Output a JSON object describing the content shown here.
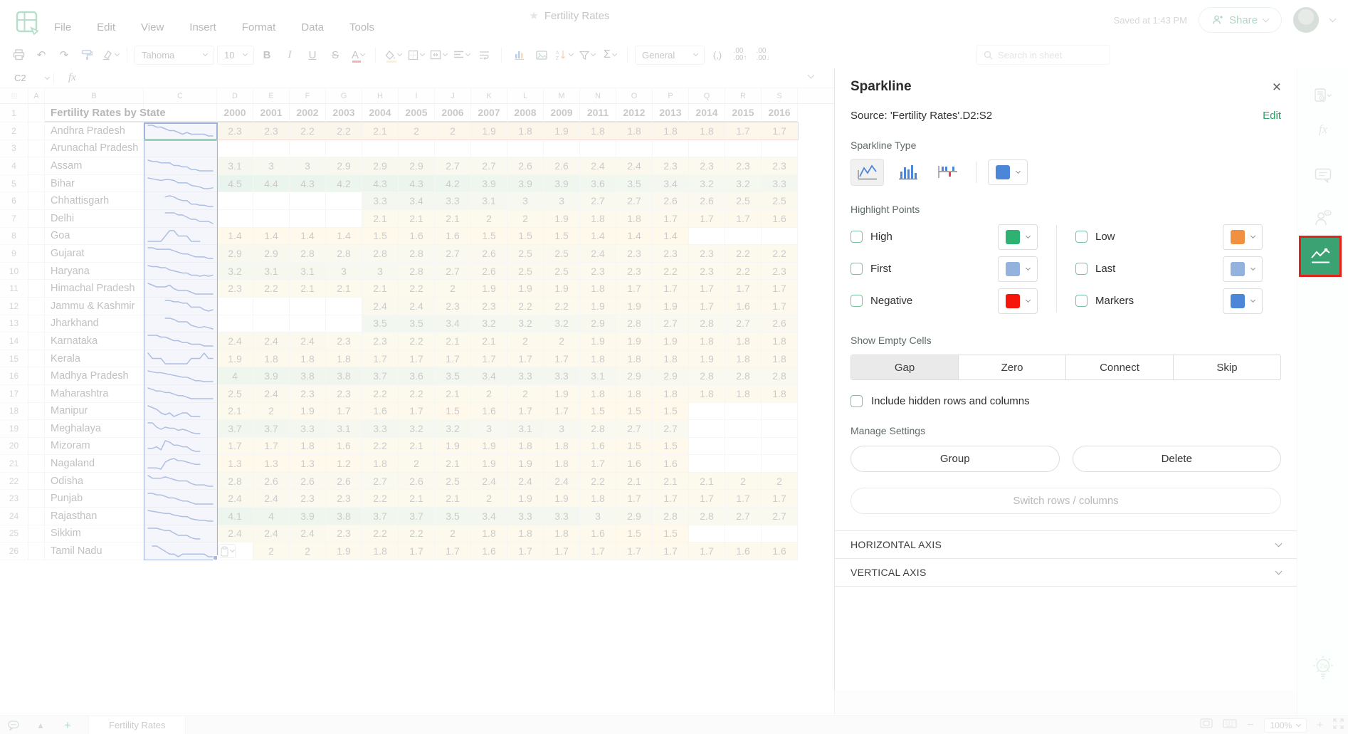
{
  "header": {
    "menus": [
      "File",
      "Edit",
      "View",
      "Insert",
      "Format",
      "Data",
      "Tools"
    ],
    "title": "Fertility Rates",
    "saved": "Saved at 1:43 PM",
    "share": "Share"
  },
  "toolbar": {
    "font_name": "Tahoma",
    "font_size": "10",
    "bold": "B",
    "italic": "I",
    "underline": "U",
    "strike": "S",
    "font_color": "A",
    "sigma": "Σ",
    "comma": "(,)",
    "decimal": ".00",
    "number_format": "General",
    "search_placeholder": "Search in sheet"
  },
  "formula_bar": {
    "cell_ref": "C2",
    "fx": "fx"
  },
  "sheet": {
    "column_letters": [
      "A",
      "B",
      "C",
      "D",
      "E",
      "F",
      "G",
      "H",
      "I",
      "J",
      "K",
      "L",
      "M",
      "N",
      "O",
      "P",
      "Q",
      "R",
      "S"
    ],
    "title_cell": "Fertility Rates by State",
    "years": [
      2000,
      2001,
      2002,
      2003,
      2004,
      2005,
      2006,
      2007,
      2008,
      2009,
      2011,
      2012,
      2013,
      2014,
      2015,
      2016
    ],
    "rows": [
      {
        "row": 2,
        "state": "Andhra Pradesh",
        "values": [
          2.3,
          2.3,
          2.2,
          2.2,
          2.1,
          2,
          2,
          1.9,
          1.8,
          1.9,
          1.8,
          1.8,
          1.8,
          1.8,
          1.7,
          1.7
        ]
      },
      {
        "row": 3,
        "state": "Arunachal Pradesh",
        "values": [
          null,
          null,
          null,
          null,
          null,
          null,
          null,
          null,
          null,
          null,
          null,
          null,
          null,
          null,
          null,
          null
        ]
      },
      {
        "row": 4,
        "state": "Assam",
        "values": [
          3.1,
          3,
          3,
          2.9,
          2.9,
          2.9,
          2.7,
          2.7,
          2.6,
          2.6,
          2.4,
          2.4,
          2.3,
          2.3,
          2.3,
          2.3
        ]
      },
      {
        "row": 5,
        "state": "Bihar",
        "values": [
          4.5,
          4.4,
          4.3,
          4.2,
          4.3,
          4.3,
          4.2,
          3.9,
          3.9,
          3.9,
          3.6,
          3.5,
          3.4,
          3.2,
          3.2,
          3.3
        ]
      },
      {
        "row": 6,
        "state": "Chhattisgarh",
        "values": [
          null,
          null,
          null,
          null,
          3.3,
          3.4,
          3.3,
          3.1,
          3,
          3,
          2.7,
          2.7,
          2.6,
          2.6,
          2.5,
          2.5
        ]
      },
      {
        "row": 7,
        "state": "Delhi",
        "values": [
          null,
          null,
          null,
          null,
          2.1,
          2.1,
          2.1,
          2,
          2,
          1.9,
          1.8,
          1.8,
          1.7,
          1.7,
          1.7,
          1.6
        ]
      },
      {
        "row": 8,
        "state": "Goa",
        "values": [
          1.4,
          1.4,
          1.4,
          1.4,
          1.5,
          1.6,
          1.6,
          1.5,
          1.5,
          1.5,
          1.4,
          1.4,
          1.4,
          null,
          null,
          null
        ]
      },
      {
        "row": 9,
        "state": "Gujarat",
        "values": [
          2.9,
          2.9,
          2.8,
          2.8,
          2.8,
          2.8,
          2.7,
          2.6,
          2.5,
          2.5,
          2.4,
          2.3,
          2.3,
          2.3,
          2.2,
          2.2
        ]
      },
      {
        "row": 10,
        "state": "Haryana",
        "values": [
          3.2,
          3.1,
          3.1,
          3,
          3,
          2.8,
          2.7,
          2.6,
          2.5,
          2.5,
          2.3,
          2.3,
          2.2,
          2.3,
          2.2,
          2.3
        ]
      },
      {
        "row": 11,
        "state": "Himachal Pradesh",
        "values": [
          2.3,
          2.2,
          2.1,
          2.1,
          2.1,
          2.2,
          2,
          1.9,
          1.9,
          1.9,
          1.8,
          1.7,
          1.7,
          1.7,
          1.7,
          1.7
        ]
      },
      {
        "row": 12,
        "state": "Jammu & Kashmir",
        "values": [
          null,
          null,
          null,
          null,
          2.4,
          2.4,
          2.3,
          2.3,
          2.2,
          2.2,
          1.9,
          1.9,
          1.9,
          1.7,
          1.6,
          1.7
        ]
      },
      {
        "row": 13,
        "state": "Jharkhand",
        "values": [
          null,
          null,
          null,
          null,
          3.5,
          3.5,
          3.4,
          3.2,
          3.2,
          3.2,
          2.9,
          2.8,
          2.7,
          2.8,
          2.7,
          2.6
        ]
      },
      {
        "row": 14,
        "state": "Karnataka",
        "values": [
          2.4,
          2.4,
          2.4,
          2.3,
          2.3,
          2.2,
          2.1,
          2.1,
          2,
          2,
          1.9,
          1.9,
          1.9,
          1.8,
          1.8,
          1.8
        ]
      },
      {
        "row": 15,
        "state": "Kerala",
        "values": [
          1.9,
          1.8,
          1.8,
          1.8,
          1.7,
          1.7,
          1.7,
          1.7,
          1.7,
          1.7,
          1.8,
          1.8,
          1.8,
          1.9,
          1.8,
          1.8
        ]
      },
      {
        "row": 16,
        "state": "Madhya Pradesh",
        "values": [
          4,
          3.9,
          3.8,
          3.8,
          3.7,
          3.6,
          3.5,
          3.4,
          3.3,
          3.3,
          3.1,
          2.9,
          2.9,
          2.8,
          2.8,
          2.8
        ]
      },
      {
        "row": 17,
        "state": "Maharashtra",
        "values": [
          2.5,
          2.4,
          2.3,
          2.3,
          2.2,
          2.2,
          2.1,
          2,
          2,
          1.9,
          1.8,
          1.8,
          1.8,
          1.8,
          1.8,
          1.8
        ]
      },
      {
        "row": 18,
        "state": "Manipur",
        "values": [
          2.1,
          2,
          1.9,
          1.7,
          1.6,
          1.7,
          1.5,
          1.6,
          1.7,
          1.7,
          1.5,
          1.5,
          1.5,
          null,
          null,
          null
        ]
      },
      {
        "row": 19,
        "state": "Meghalaya",
        "values": [
          3.7,
          3.7,
          3.3,
          3.1,
          3.3,
          3.2,
          3.2,
          3,
          3.1,
          3,
          2.8,
          2.7,
          2.7,
          null,
          null,
          null
        ]
      },
      {
        "row": 20,
        "state": "Mizoram",
        "values": [
          1.7,
          1.7,
          1.8,
          1.6,
          2.2,
          2.1,
          1.9,
          1.9,
          1.8,
          1.8,
          1.6,
          1.5,
          1.5,
          null,
          null,
          null
        ]
      },
      {
        "row": 21,
        "state": "Nagaland",
        "values": [
          1.3,
          1.3,
          1.3,
          1.2,
          1.8,
          2,
          2.1,
          1.9,
          1.9,
          1.8,
          1.7,
          1.6,
          1.6,
          null,
          null,
          null
        ]
      },
      {
        "row": 22,
        "state": "Odisha",
        "values": [
          2.8,
          2.6,
          2.6,
          2.6,
          2.7,
          2.6,
          2.5,
          2.4,
          2.4,
          2.4,
          2.2,
          2.1,
          2.1,
          2.1,
          2,
          2
        ]
      },
      {
        "row": 23,
        "state": "Punjab",
        "values": [
          2.4,
          2.4,
          2.3,
          2.3,
          2.2,
          2.1,
          2.1,
          2,
          1.9,
          1.9,
          1.8,
          1.7,
          1.7,
          1.7,
          1.7,
          1.7
        ]
      },
      {
        "row": 24,
        "state": "Rajasthan",
        "values": [
          4.1,
          4,
          3.9,
          3.8,
          3.7,
          3.7,
          3.5,
          3.4,
          3.3,
          3.3,
          3,
          2.9,
          2.8,
          2.8,
          2.7,
          2.7
        ]
      },
      {
        "row": 25,
        "state": "Sikkim",
        "values": [
          2.4,
          2.4,
          2.4,
          2.3,
          2.2,
          2.2,
          2,
          1.8,
          1.8,
          1.8,
          1.6,
          1.5,
          1.5,
          null,
          null,
          null
        ]
      },
      {
        "row": 26,
        "state": "Tamil Nadu",
        "paste_icon": true,
        "values": [
          null,
          2,
          2,
          1.9,
          1.8,
          1.7,
          1.7,
          1.6,
          1.7,
          1.7,
          1.7,
          1.7,
          1.7,
          1.7,
          1.6,
          1.6
        ]
      }
    ],
    "sparkline_color": "#4d72bd"
  },
  "panel": {
    "title": "Sparkline",
    "source": "Source: 'Fertility Rates'.D2:S2",
    "edit": "Edit",
    "type_section": "Sparkline Type",
    "line_color": "#4c86d9",
    "highlight_section": "Highlight Points",
    "options_left": [
      {
        "label": "High",
        "color": "#2eb273"
      },
      {
        "label": "First",
        "color": "#93b2de"
      },
      {
        "label": "Negative",
        "color": "#f6150a"
      }
    ],
    "options_right": [
      {
        "label": "Low",
        "color": "#ef9140"
      },
      {
        "label": "Last",
        "color": "#93b2de"
      },
      {
        "label": "Markers",
        "color": "#4c86d9"
      }
    ],
    "empty_section": "Show Empty Cells",
    "empty_options": [
      "Gap",
      "Zero",
      "Connect",
      "Skip"
    ],
    "empty_selected": "Gap",
    "include_hidden": "Include hidden rows and columns",
    "manage_section": "Manage Settings",
    "group": "Group",
    "delete": "Delete",
    "switch": "Switch rows / columns",
    "h_axis": "HORIZONTAL AXIS",
    "v_axis": "VERTICAL AXIS"
  },
  "bottom_bar": {
    "sheet_tab": "Fertility Rates",
    "zoom": "100%"
  }
}
